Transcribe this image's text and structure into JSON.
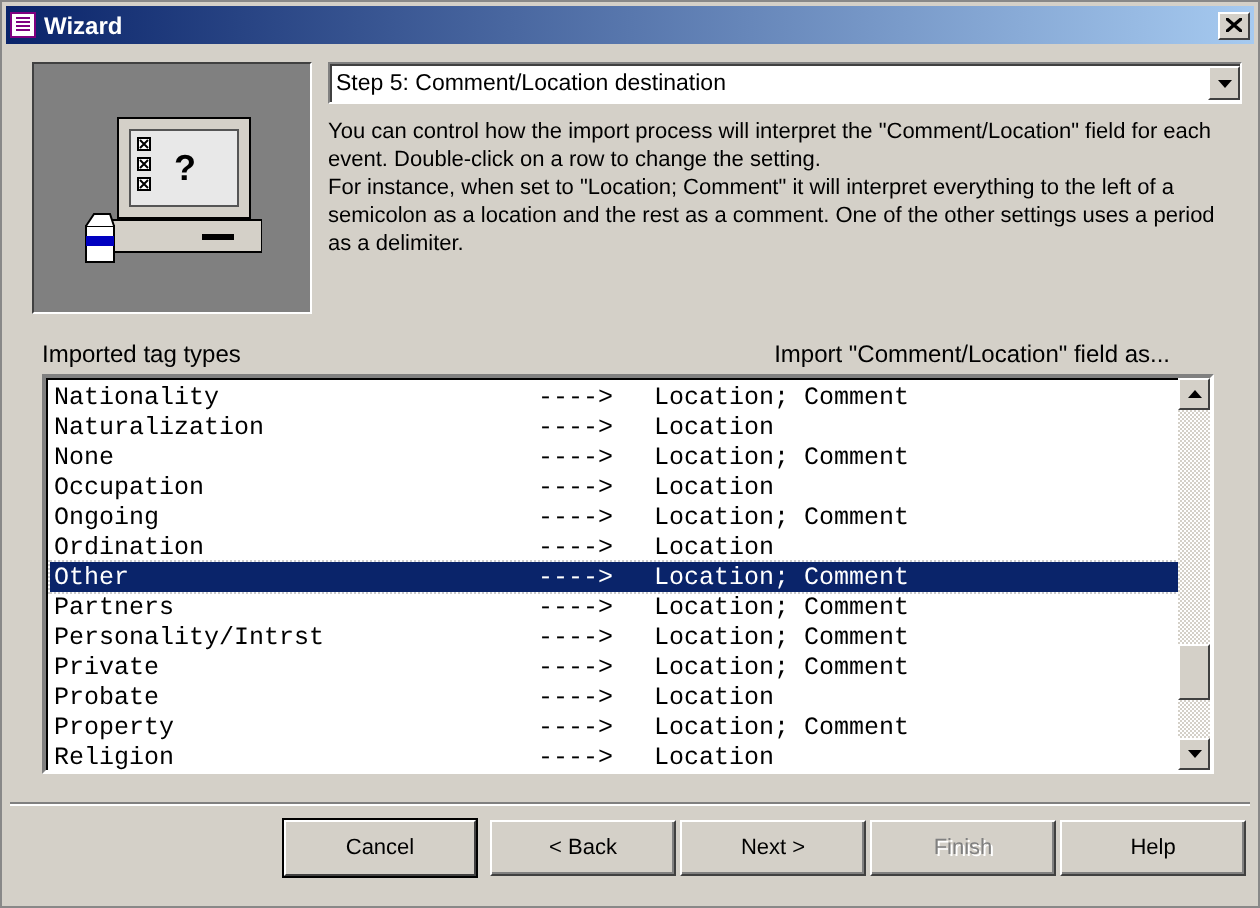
{
  "window": {
    "title": "Wizard"
  },
  "wizard_art": {
    "screen_mark": "?"
  },
  "step_dropdown": {
    "value": "Step 5: Comment/Location destination"
  },
  "description": [
    "You can control how the import process will interpret the \"Comment/Location\" field for each event.  Double-click on a row to change the setting.",
    "For instance, when set to \"Location; Comment\" it will interpret everything to the left of a semicolon as a location and the rest as a comment.  One of the other settings uses a period as a delimiter."
  ],
  "list_headers": {
    "left": "Imported tag types",
    "right": "Import \"Comment/Location\" field as..."
  },
  "rows": [
    {
      "tag": "Nationality",
      "arrow": "---->",
      "setting": "Location; Comment",
      "selected": false
    },
    {
      "tag": "Naturalization",
      "arrow": "---->",
      "setting": "Location",
      "selected": false
    },
    {
      "tag": "None",
      "arrow": "---->",
      "setting": "Location; Comment",
      "selected": false
    },
    {
      "tag": "Occupation",
      "arrow": "---->",
      "setting": "Location",
      "selected": false
    },
    {
      "tag": "Ongoing",
      "arrow": "---->",
      "setting": "Location; Comment",
      "selected": false
    },
    {
      "tag": "Ordination",
      "arrow": "---->",
      "setting": "Location",
      "selected": false
    },
    {
      "tag": "Other",
      "arrow": "---->",
      "setting": "Location; Comment",
      "selected": true
    },
    {
      "tag": "Partners",
      "arrow": "---->",
      "setting": "Location; Comment",
      "selected": false
    },
    {
      "tag": "Personality/Intrst",
      "arrow": "---->",
      "setting": "Location; Comment",
      "selected": false
    },
    {
      "tag": "Private",
      "arrow": "---->",
      "setting": "Location; Comment",
      "selected": false
    },
    {
      "tag": "Probate",
      "arrow": "---->",
      "setting": "Location",
      "selected": false
    },
    {
      "tag": "Property",
      "arrow": "---->",
      "setting": "Location; Comment",
      "selected": false
    },
    {
      "tag": "Religion",
      "arrow": "---->",
      "setting": "Location",
      "selected": false
    }
  ],
  "buttons": [
    {
      "label": "Cancel",
      "default": true,
      "disabled": false
    },
    {
      "label": "< Back",
      "default": false,
      "disabled": false
    },
    {
      "label": "Next >",
      "default": false,
      "disabled": false
    },
    {
      "label": "Finish",
      "default": false,
      "disabled": true
    },
    {
      "label": "Help",
      "default": false,
      "disabled": false
    }
  ]
}
